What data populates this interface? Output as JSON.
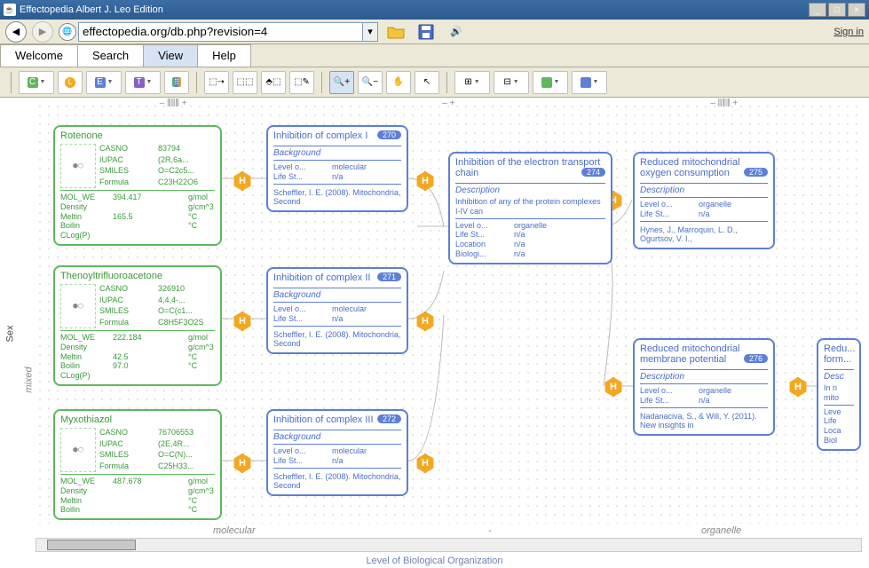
{
  "window": {
    "title": "Effectopedia  Albert J. Leo Edition"
  },
  "nav": {
    "url": "effectopedia.org/db.php?revision=4",
    "signin": "Sign in"
  },
  "tabs": [
    "Welcome",
    "Search",
    "View",
    "Help"
  ],
  "active_tab": 2,
  "axes": {
    "y": "Sex",
    "y2": "mixed",
    "x": "Level of Biological Organization",
    "xticks": [
      "molecular",
      "-",
      "organelle"
    ],
    "ruler": [
      "– ⫼⫼⫼ +",
      "– +",
      "– ⫼⫼⫼ +"
    ]
  },
  "hex_label": "H",
  "chart_data": {
    "type": "diagram",
    "chemicals": [
      {
        "name": "Rotenone",
        "props": {
          "CASNO": "83794",
          "IUPAC": "(2R,6a...",
          "SMILES": "O=C2c5...",
          "Formula": "C23H22O6"
        },
        "phys": [
          [
            "MOL_WE",
            "394.417",
            "g/mol"
          ],
          [
            "Density",
            "",
            "g/cm^3"
          ],
          [
            "Meltin",
            "165.5",
            "°C"
          ],
          [
            "Boilin",
            "",
            "°C"
          ],
          [
            "CLog(P)",
            "",
            ""
          ]
        ]
      },
      {
        "name": "Thenoyltrifluoroacetone",
        "props": {
          "CASNO": "326910",
          "IUPAC": "4,4,4-...",
          "SMILES": "O=C(c1...",
          "Formula": "C8H5F3O2S"
        },
        "phys": [
          [
            "MOL_WE",
            "222.184",
            "g/mol"
          ],
          [
            "Density",
            "",
            "g/cm^3"
          ],
          [
            "Meltin",
            "42.5",
            "°C"
          ],
          [
            "Boilin",
            "97.0",
            "°C"
          ],
          [
            "CLog(P)",
            "",
            ""
          ]
        ]
      },
      {
        "name": "Myxothiazol",
        "props": {
          "CASNO": "76706553",
          "IUPAC": "(2E,4R...",
          "SMILES": "O=C(N)...",
          "Formula": "C25H33..."
        },
        "phys": [
          [
            "MOL_WE",
            "487.678",
            "g/mol"
          ],
          [
            "Density",
            "",
            "g/cm^3"
          ],
          [
            "Meltin",
            "",
            "°C"
          ],
          [
            "Boilin",
            "",
            "°C"
          ]
        ]
      }
    ],
    "effects_col1": [
      {
        "title": "Inhibition of complex I",
        "badge": "270",
        "subhead": "Background",
        "kv": [
          [
            "Level o...",
            "molecular"
          ],
          [
            "Life St...",
            "n/a"
          ]
        ],
        "ref": "Scheffler, I. E. (2008). Mitochondria, Second"
      },
      {
        "title": "Inhibition of complex II",
        "badge": "271",
        "subhead": "Background",
        "kv": [
          [
            "Level o...",
            "molecular"
          ],
          [
            "Life St...",
            "n/a"
          ]
        ],
        "ref": "Scheffler, I. E. (2008). Mitochondria, Second"
      },
      {
        "title": "Inhibition of complex III",
        "badge": "272",
        "subhead": "Background",
        "kv": [
          [
            "Level o...",
            "molecular"
          ],
          [
            "Life St...",
            "n/a"
          ]
        ],
        "ref": "Scheffler, I. E. (2008). Mitochondria, Second"
      }
    ],
    "effects_col2": [
      {
        "title": "Inhibition of the electron transport chain",
        "badge": "274",
        "subhead": "Description",
        "desc": "Inhibition of any of the protein complexes I-IV can",
        "kv": [
          [
            "Level o...",
            "organelle"
          ],
          [
            "Life St...",
            "n/a"
          ],
          [
            "Location",
            "n/a"
          ],
          [
            "Biologi...",
            "n/a"
          ]
        ]
      }
    ],
    "effects_col3": [
      {
        "title": "Reduced mitochondrial oxygen consumption",
        "badge": "275",
        "subhead": "Description",
        "kv": [
          [
            "Level o...",
            "organelle"
          ],
          [
            "Life St...",
            "n/a"
          ]
        ],
        "ref": "Hynes, J., Marroquin, L. D., Ogurtsov, V. I.,"
      },
      {
        "title": "Reduced mitochondrial membrane potential",
        "badge": "276",
        "subhead": "Description",
        "kv": [
          [
            "Level o...",
            "organelle"
          ],
          [
            "Life St...",
            "n/a"
          ]
        ],
        "ref": "Nadanaciva, S., & Will, Y. (2011). New insights in"
      }
    ],
    "partial": {
      "title": "Redu... form...",
      "subhead": "Desc",
      "desc": "In n\nmito",
      "kv": [
        [
          "Leve",
          ""
        ],
        [
          "Life",
          ""
        ],
        [
          "Loca",
          ""
        ],
        [
          "Biol",
          ""
        ]
      ]
    }
  }
}
